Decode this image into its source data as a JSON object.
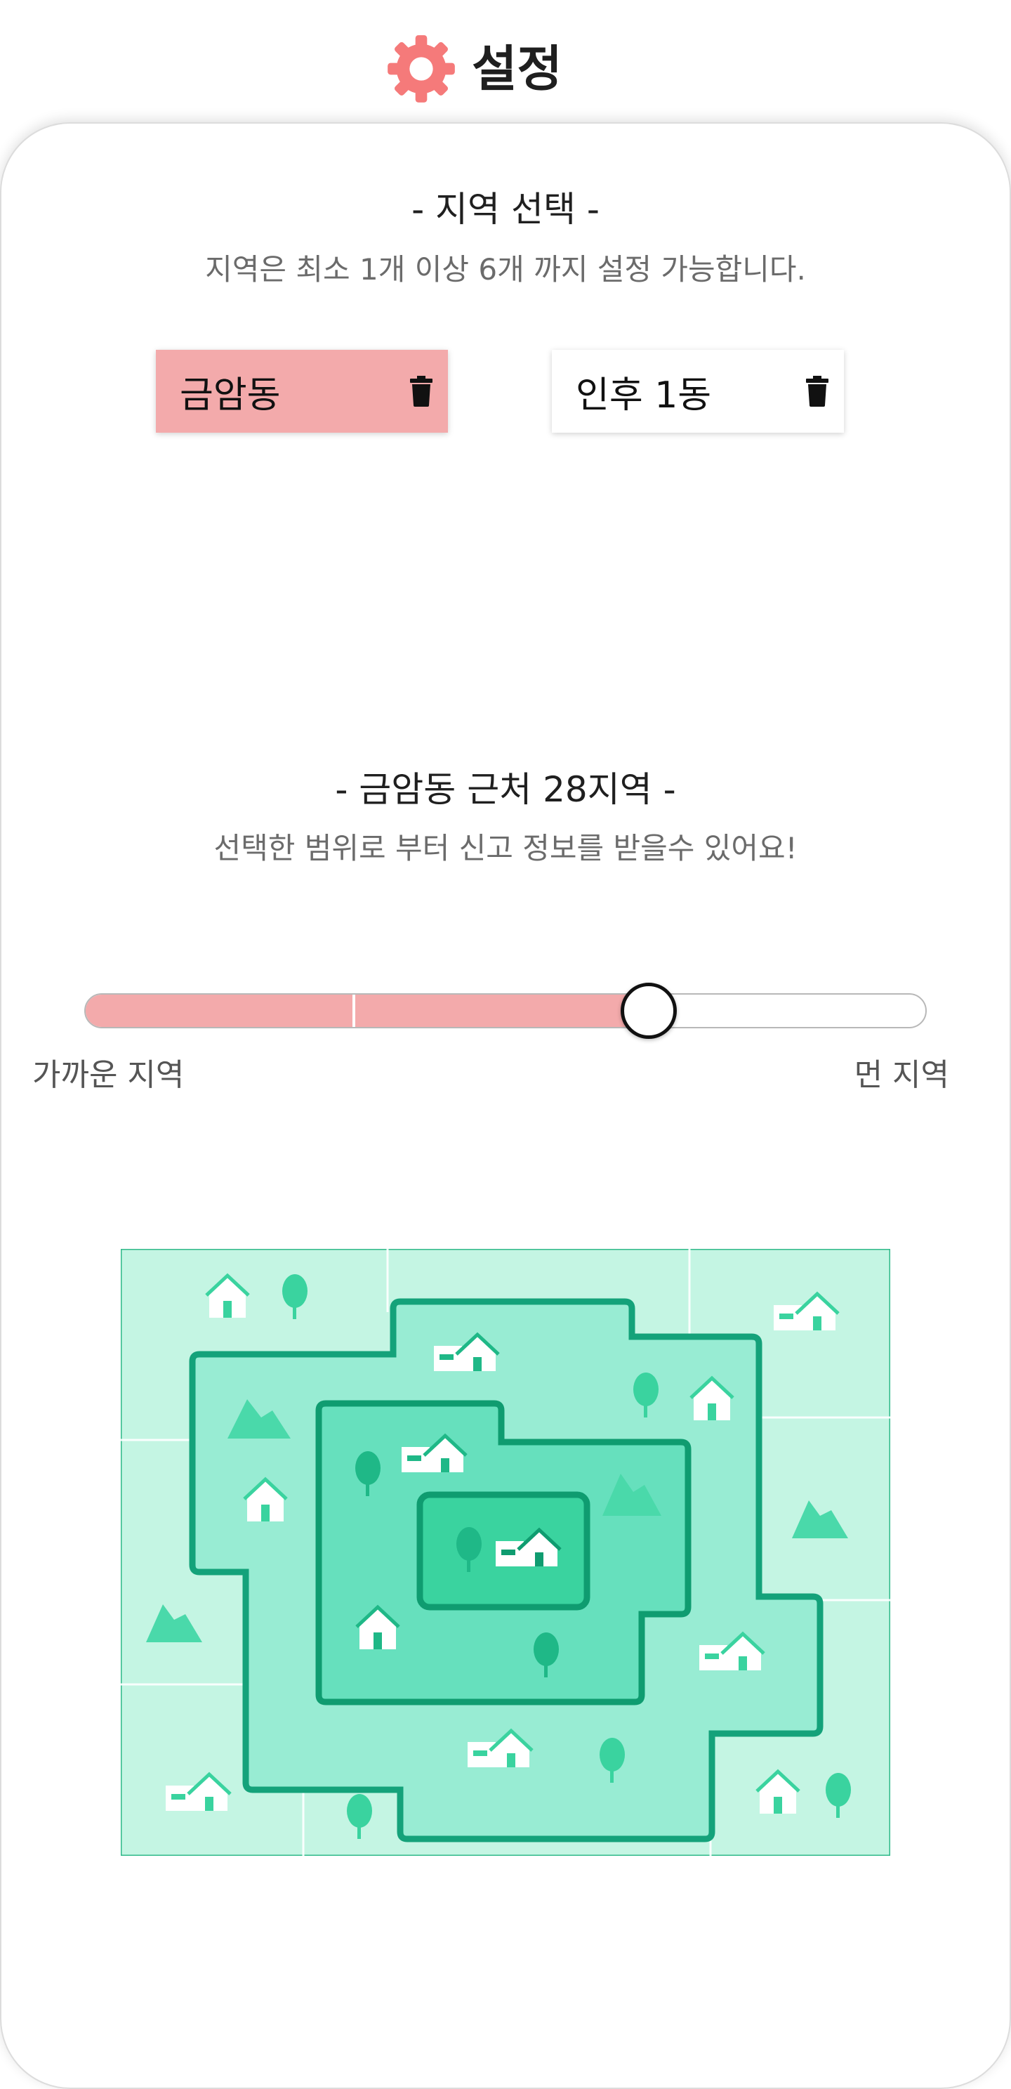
{
  "header": {
    "title": "설정",
    "icon": "gear-icon",
    "accent": "#f57a7a"
  },
  "region_section": {
    "heading": "- 지역 선택 -",
    "subtitle": "지역은 최소 1개 이상 6개 까지 설정 가능합니다.",
    "chips": [
      {
        "label": "금암동",
        "selected": true
      },
      {
        "label": "인후 1동",
        "selected": false
      }
    ]
  },
  "range_section": {
    "heading": "- 금암동 근처 28지역 -",
    "subtitle": "선택한 범위로 부터 신고 정보를 받을수 있어요!",
    "slider": {
      "value": 0.67,
      "near_label": "가까운 지역",
      "far_label": "먼 지역"
    }
  },
  "colors": {
    "accent_pink": "#f3aaab",
    "gear": "#f57a7a",
    "map_light": "#c4f5e3",
    "map_mid": "#98ecd3",
    "map_deep": "#66e0bd",
    "map_core": "#3ad39f",
    "map_border": "#0f9c70"
  }
}
